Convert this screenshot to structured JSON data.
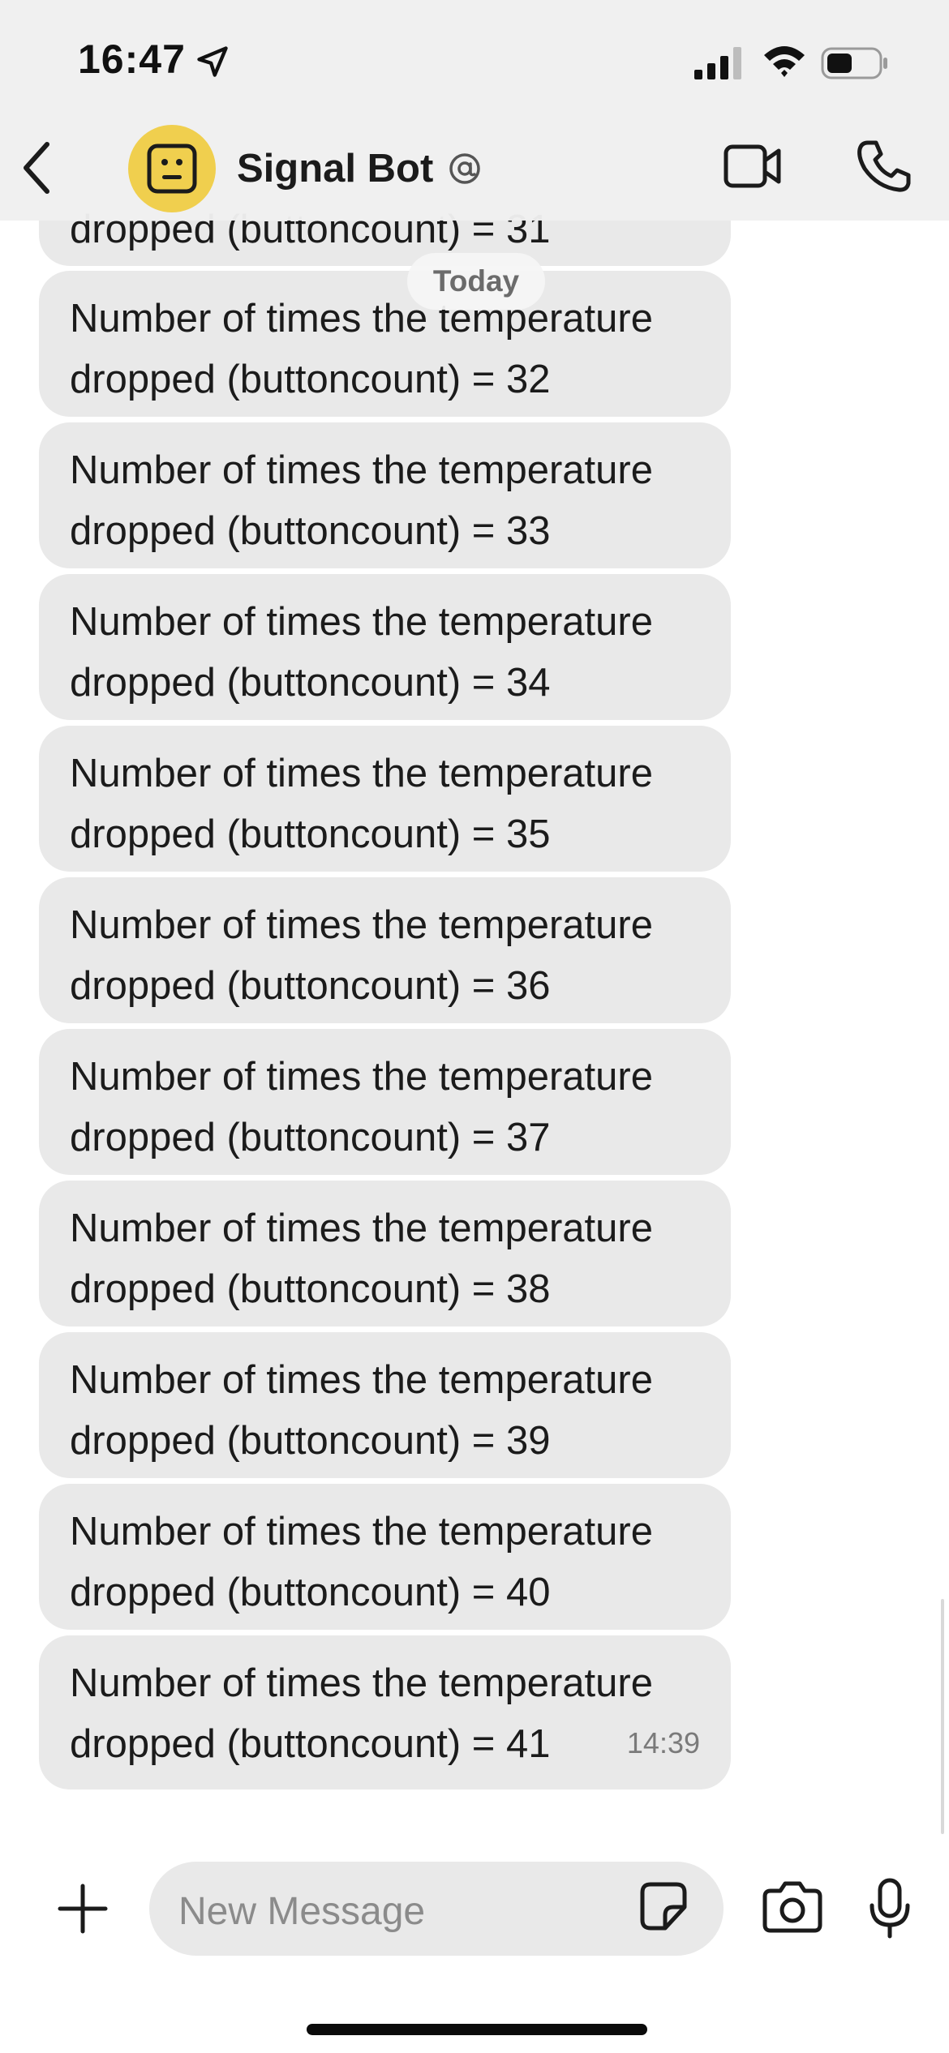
{
  "status_bar": {
    "time": "16:47",
    "icons": [
      "location-arrow-icon",
      "cellular-signal-icon",
      "wifi-icon",
      "battery-icon"
    ]
  },
  "header": {
    "contact_name": "Signal Bot",
    "avatar_icon": "bot-face-icon",
    "avatar_color": "#f0cf4e",
    "icons": [
      "back-chevron-icon",
      "verified-at-icon",
      "video-camera-icon",
      "phone-icon"
    ]
  },
  "conversation": {
    "date_divider": "Today",
    "partial_message": {
      "line2": "dropped (buttoncount) = 31"
    },
    "messages": [
      {
        "line1": "Number of times the temperature",
        "line2": "dropped (buttoncount) = 32"
      },
      {
        "line1": "Number of times the temperature",
        "line2": "dropped (buttoncount) = 33"
      },
      {
        "line1": "Number of times the temperature",
        "line2": "dropped (buttoncount) = 34"
      },
      {
        "line1": "Number of times the temperature",
        "line2": "dropped (buttoncount) = 35"
      },
      {
        "line1": "Number of times the temperature",
        "line2": "dropped (buttoncount) = 36"
      },
      {
        "line1": "Number of times the temperature",
        "line2": "dropped (buttoncount) = 37"
      },
      {
        "line1": "Number of times the temperature",
        "line2": "dropped (buttoncount) = 38"
      },
      {
        "line1": "Number of times the temperature",
        "line2": "dropped (buttoncount) = 39"
      },
      {
        "line1": "Number of times the temperature",
        "line2": "dropped (buttoncount) = 40"
      },
      {
        "line1": "Number of times the temperature",
        "line2": "dropped (buttoncount) = 41",
        "time": "14:39"
      }
    ],
    "bubble_color": "#e9e9e9"
  },
  "composer": {
    "placeholder": "New Message",
    "icons": [
      "plus-icon",
      "sticker-icon",
      "camera-icon",
      "microphone-icon"
    ]
  }
}
